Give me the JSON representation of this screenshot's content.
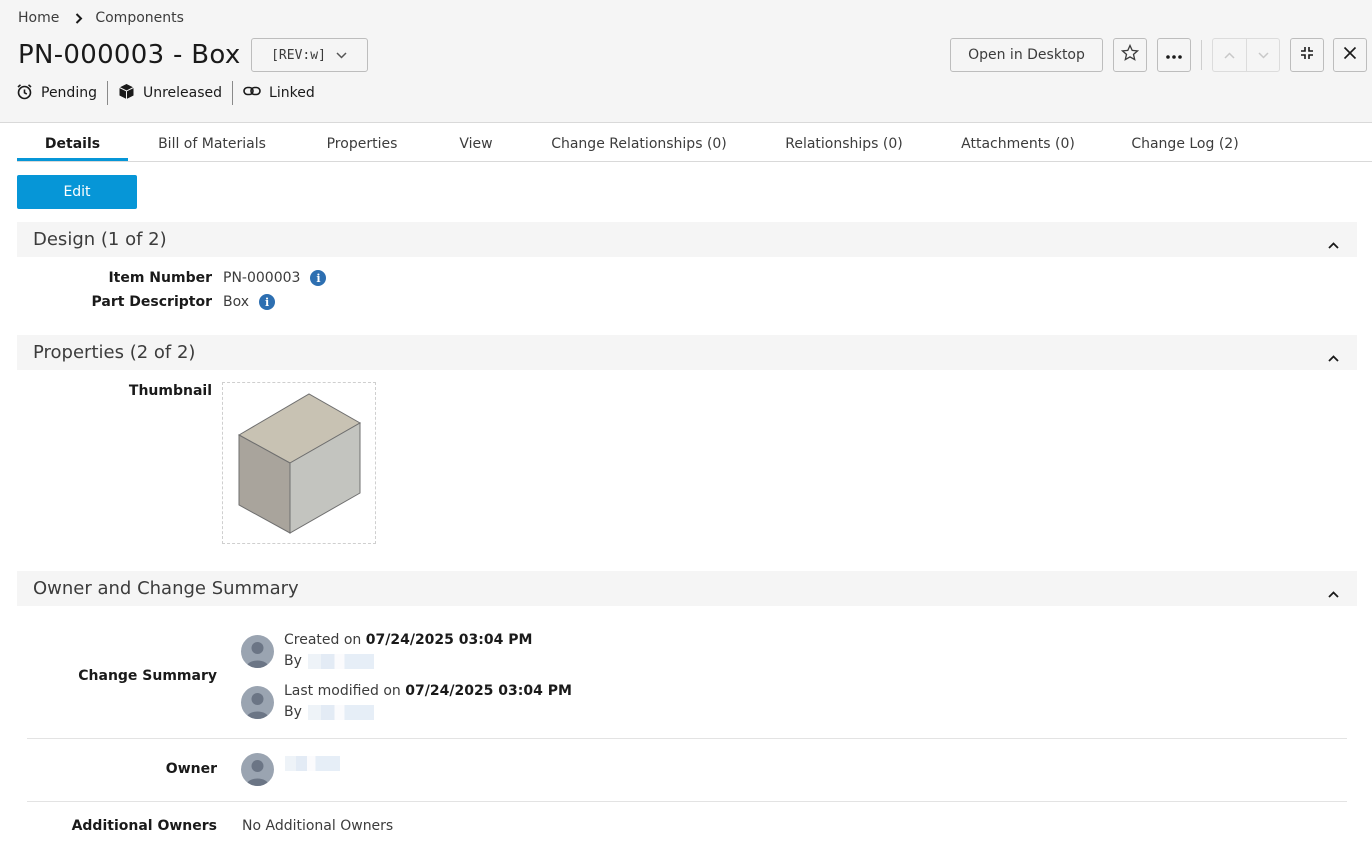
{
  "breadcrumb": {
    "home": "Home",
    "current": "Components"
  },
  "title": "PN-000003 - Box",
  "revision": "[REV:w]",
  "status": {
    "state": "Pending",
    "release": "Unreleased",
    "link": "Linked"
  },
  "header_buttons": {
    "open_desktop": "Open in Desktop"
  },
  "tabs": [
    {
      "label": "Details",
      "active": true
    },
    {
      "label": "Bill of Materials"
    },
    {
      "label": "Properties"
    },
    {
      "label": "View"
    },
    {
      "label": "Change Relationships (0)"
    },
    {
      "label": "Relationships (0)"
    },
    {
      "label": "Attachments (0)"
    },
    {
      "label": "Change Log (2)"
    }
  ],
  "edit_label": "Edit",
  "sections": {
    "design": {
      "title": "Design (1 of 2)",
      "item_number_label": "Item Number",
      "item_number": "PN-000003",
      "descriptor_label": "Part Descriptor",
      "descriptor": "Box"
    },
    "properties": {
      "title": "Properties (2 of 2)",
      "thumbnail_label": "Thumbnail"
    },
    "owner": {
      "title": "Owner and Change Summary",
      "change_summary_label": "Change Summary",
      "created_prefix": "Created on",
      "created_date": "07/24/2025 03:04 PM",
      "by_label": "By",
      "modified_prefix": "Last modified on",
      "modified_date": "07/24/2025 03:04 PM",
      "owner_label": "Owner",
      "additional_owners_label": "Additional Owners",
      "additional_owners_value": "No Additional Owners"
    }
  },
  "colors": {
    "accent": "#0696d7",
    "info": "#2d6fb1"
  }
}
